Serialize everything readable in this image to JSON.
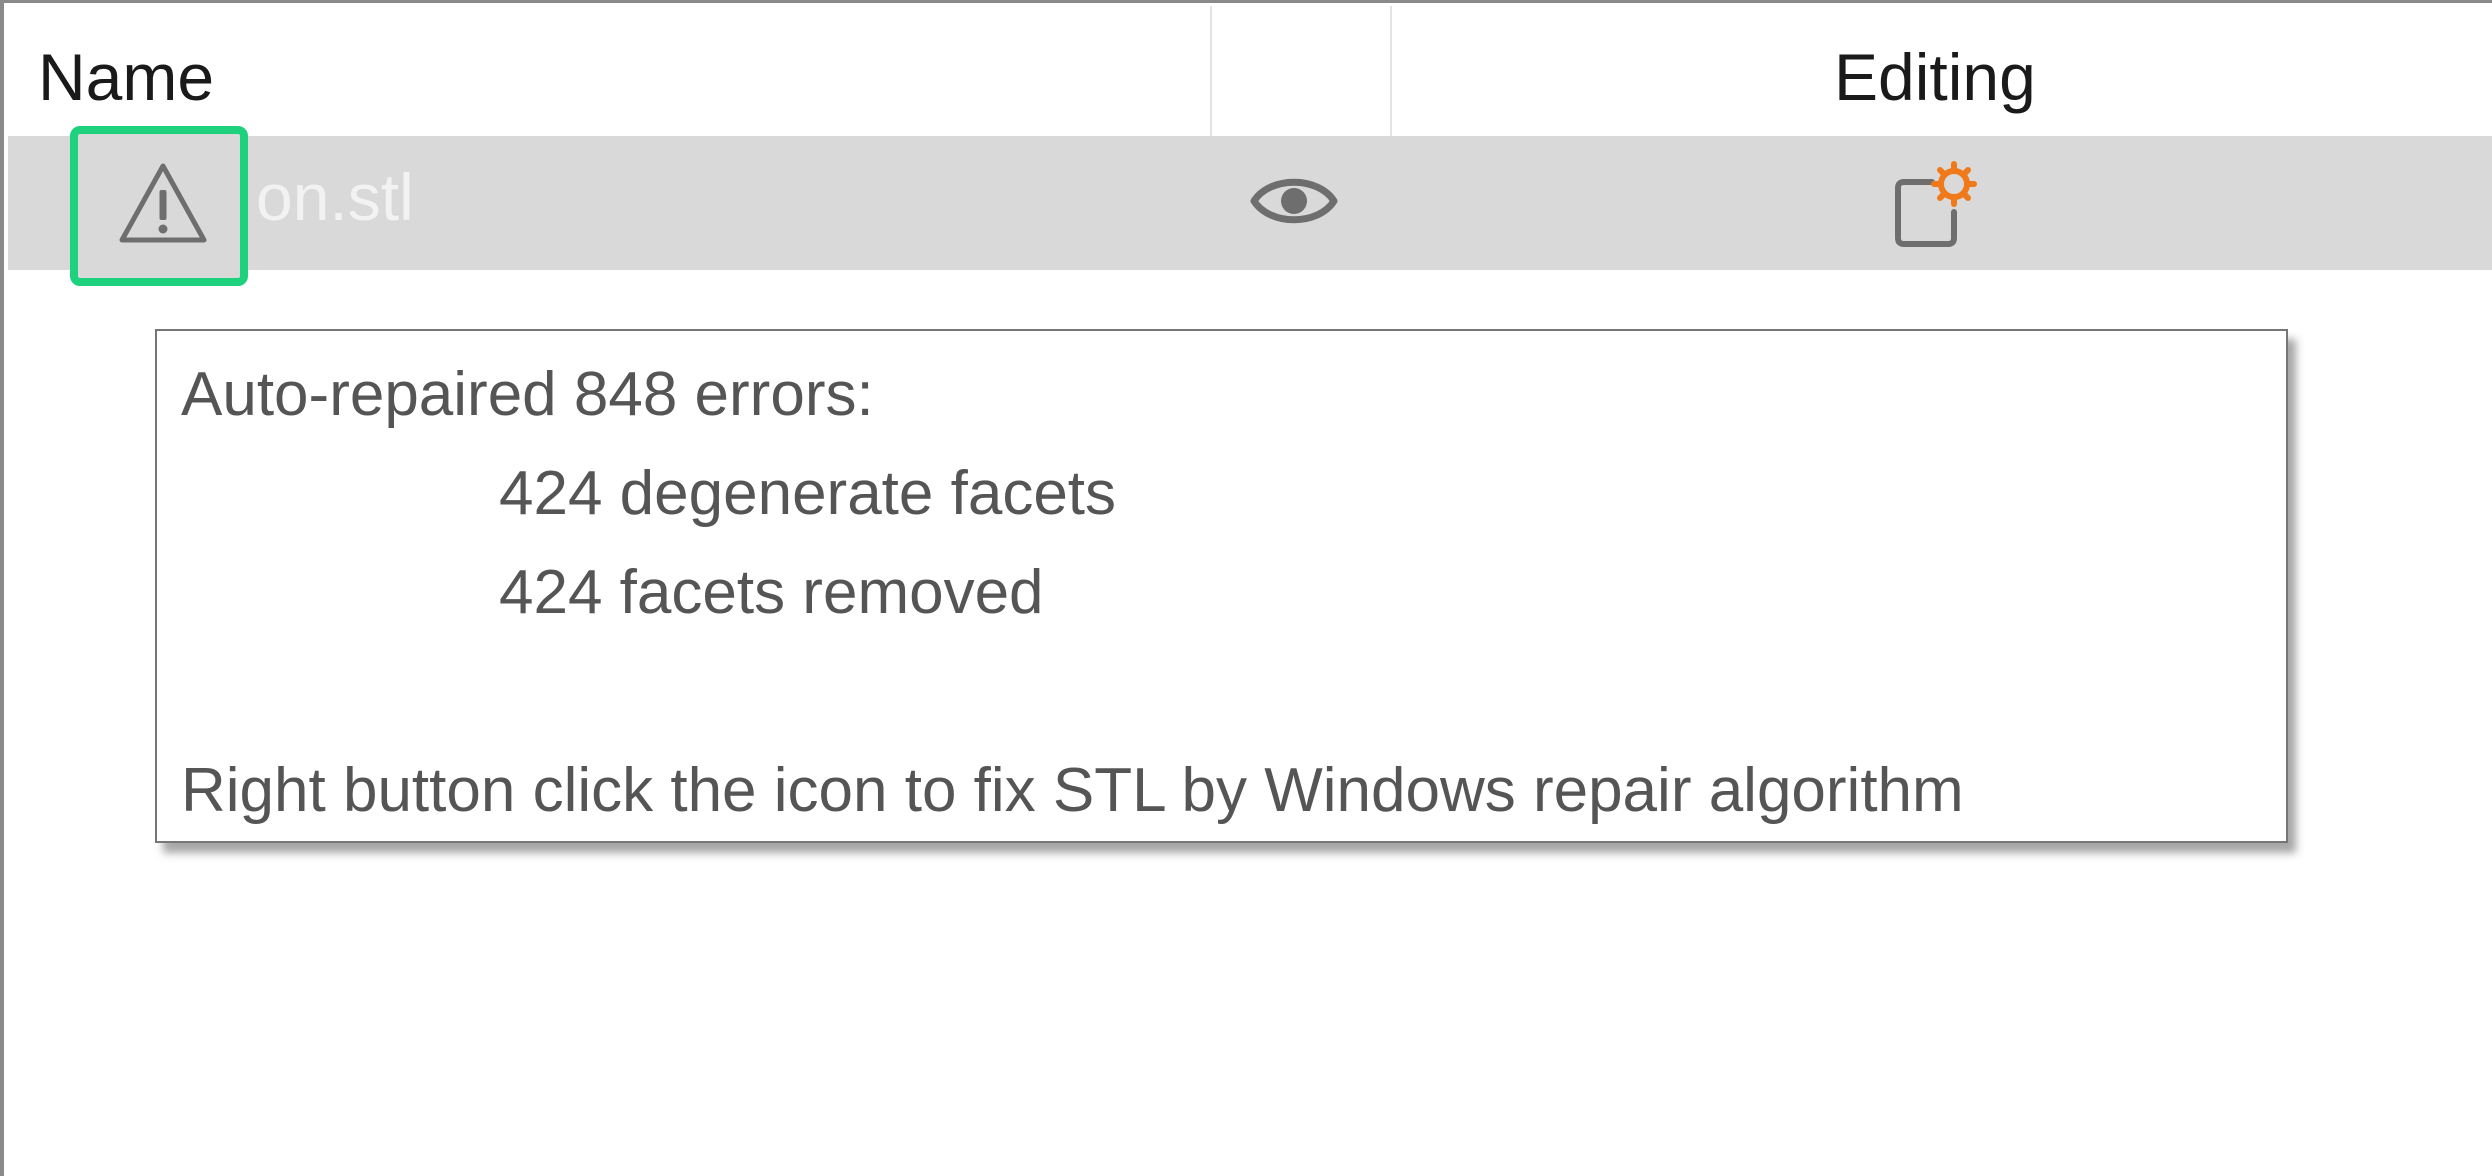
{
  "table": {
    "headers": {
      "name": "Name",
      "visibility": "",
      "editing": "Editing"
    },
    "rows": [
      {
        "filename": "on.stl",
        "status_icon": "warning-triangle-icon",
        "visibility_icon": "eye-icon",
        "editing_icon": "edit-settings-icon"
      }
    ]
  },
  "tooltip": {
    "title": "Auto-repaired 848 errors:",
    "details": [
      "424 degenerate facets",
      "424 facets removed"
    ],
    "hint": "Right button click the icon to fix STL by Windows repair algorithm"
  },
  "colors": {
    "row_selected_bg": "#d9d9d9",
    "highlight_border": "#1dd17d",
    "accent_orange": "#f07a1a",
    "icon_gray": "#6e6e6e"
  }
}
